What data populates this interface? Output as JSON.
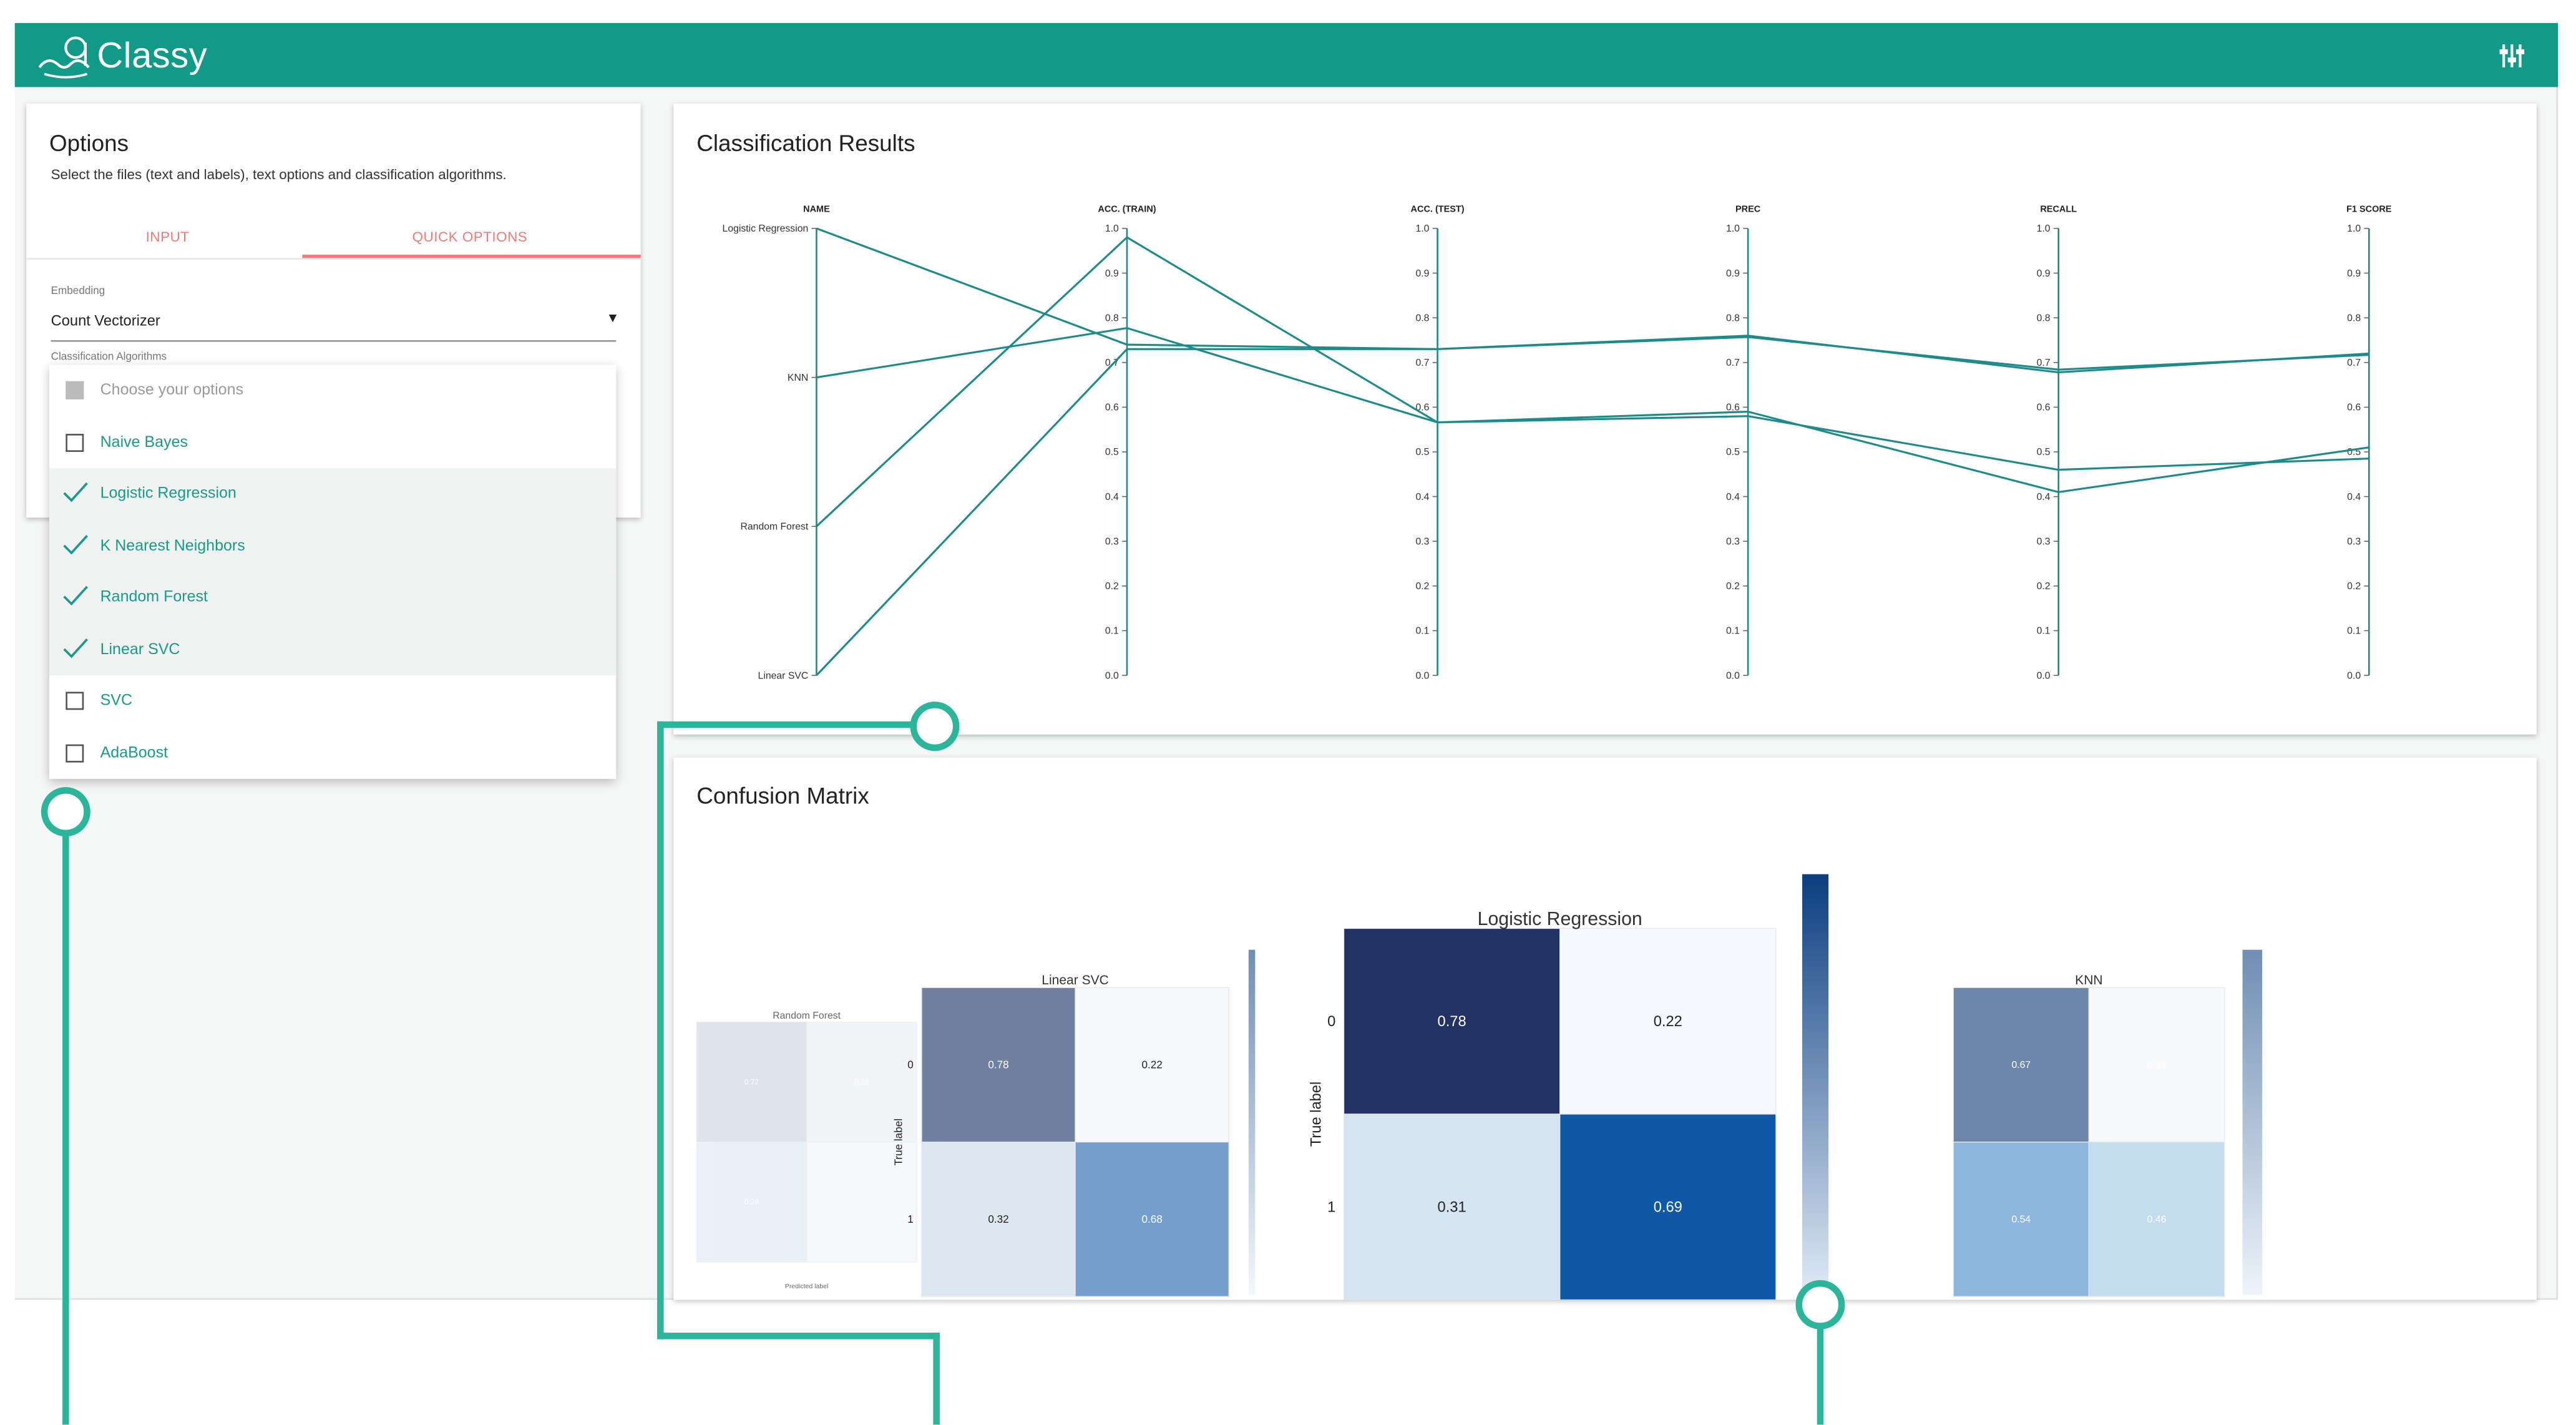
{
  "app": {
    "title": "Classy"
  },
  "icons": {
    "logo": "mustache-face-logo-icon",
    "settings": "sliders-icon"
  },
  "colors": {
    "brand": "#129a89",
    "accent": "#ef7a77",
    "chart_line": "#1f8a8a",
    "annotation": "#2bb59a"
  },
  "options": {
    "title": "Options",
    "subtitle": "Select the files (text and labels), text options and classification algorithms.",
    "tabs": [
      {
        "label": "INPUT",
        "active": false
      },
      {
        "label": "QUICK OPTIONS",
        "active": true
      }
    ],
    "embedding": {
      "label": "Embedding",
      "value": "Count Vectorizer"
    },
    "algorithms": {
      "label": "Classification Algorithms",
      "placeholder": "Choose your options",
      "items": [
        {
          "label": "Naive Bayes",
          "checked": false
        },
        {
          "label": "Logistic Regression",
          "checked": true
        },
        {
          "label": "K Nearest Neighbors",
          "checked": true
        },
        {
          "label": "Random Forest",
          "checked": true
        },
        {
          "label": "Linear SVC",
          "checked": true
        },
        {
          "label": "SVC",
          "checked": false
        },
        {
          "label": "AdaBoost",
          "checked": false
        }
      ]
    }
  },
  "results": {
    "title": "Classification Results"
  },
  "confusion": {
    "title": "Confusion Matrix"
  },
  "chart_data": [
    {
      "type": "parallel-coordinates",
      "axes": [
        "NAME",
        "ACC. (TRAIN)",
        "ACC. (TEST)",
        "PREC",
        "RECALL",
        "F1 SCORE"
      ],
      "ticks": [
        "0.0",
        "0.1",
        "0.2",
        "0.3",
        "0.4",
        "0.5",
        "0.6",
        "0.7",
        "0.8",
        "0.9",
        "1.0"
      ],
      "ylim": [
        0,
        1
      ],
      "categories": [
        "Logistic Regression",
        "KNN",
        "Random Forest",
        "Linear SVC"
      ],
      "series": [
        {
          "name": "Logistic Regression",
          "values": [
            0.74,
            0.73,
            0.757,
            0.684,
            0.717
          ]
        },
        {
          "name": "KNN",
          "values": [
            0.777,
            0.566,
            0.59,
            0.41,
            0.51
          ]
        },
        {
          "name": "Random Forest",
          "values": [
            0.98,
            0.566,
            0.58,
            0.46,
            0.485
          ]
        },
        {
          "name": "Linear SVC",
          "values": [
            0.73,
            0.73,
            0.76,
            0.678,
            0.72
          ]
        }
      ]
    },
    {
      "type": "heatmap",
      "title": "Random Forest",
      "xlabel": "Predicted label",
      "ylabel": "",
      "cells": [
        [
          "0.72",
          "0.28"
        ],
        [
          "0.28",
          ""
        ]
      ]
    },
    {
      "type": "heatmap",
      "title": "Linear SVC",
      "ylabel": "True label",
      "rows": [
        "0",
        "1"
      ],
      "cells": [
        [
          "0.78",
          "0.22"
        ],
        [
          "0.32",
          "0.68"
        ]
      ]
    },
    {
      "type": "heatmap",
      "title": "Logistic Regression",
      "ylabel": "True label",
      "rows": [
        "0",
        "1"
      ],
      "cells": [
        [
          "0.78",
          "0.22"
        ],
        [
          "0.31",
          "0.69"
        ]
      ]
    },
    {
      "type": "heatmap",
      "title": "KNN",
      "cells": [
        [
          "0.67",
          "0.33"
        ],
        [
          "0.54",
          "0.46"
        ]
      ]
    }
  ]
}
